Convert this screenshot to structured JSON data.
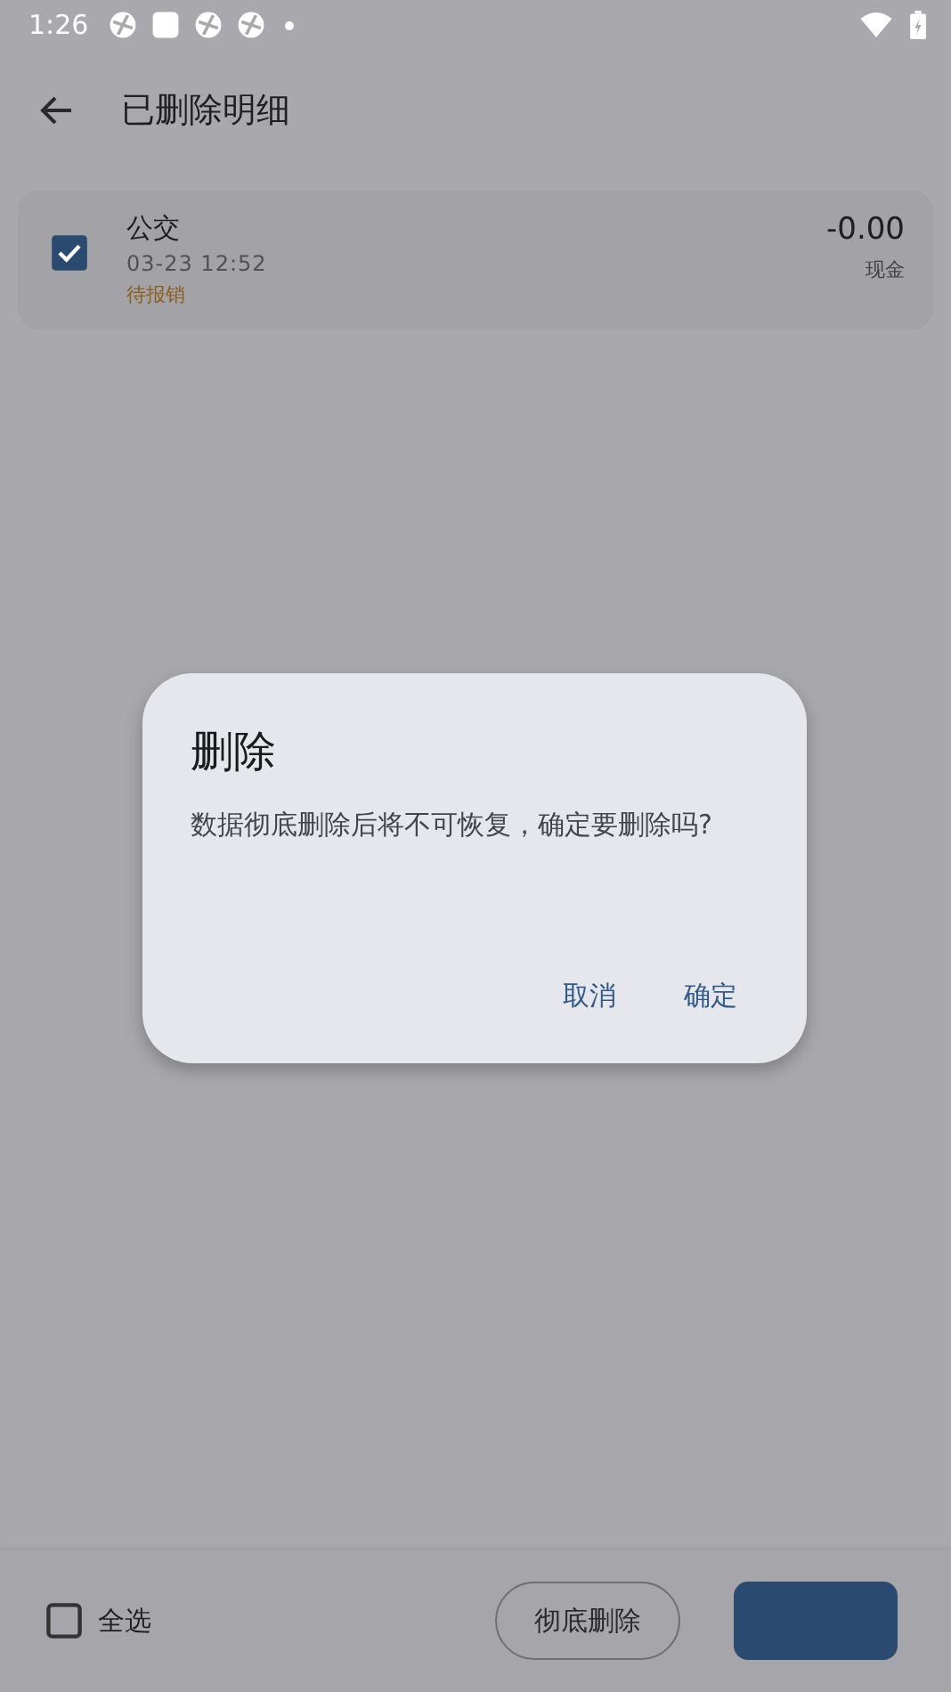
{
  "status_bar": {
    "time": "1:26"
  },
  "header": {
    "title": "已删除明细"
  },
  "items": [
    {
      "name": "公交",
      "time": "03-23 12:52",
      "status": "待报销",
      "amount": "-0.00",
      "account": "现金",
      "checked": true
    }
  ],
  "bottom_bar": {
    "select_all": {
      "label": "全选",
      "checked": false
    },
    "delete_button": "彻底删除"
  },
  "dialog": {
    "title": "删除",
    "message": "数据彻底删除后将不可恢复，确定要删除吗?",
    "buttons": [
      "取消",
      "确定"
    ]
  }
}
